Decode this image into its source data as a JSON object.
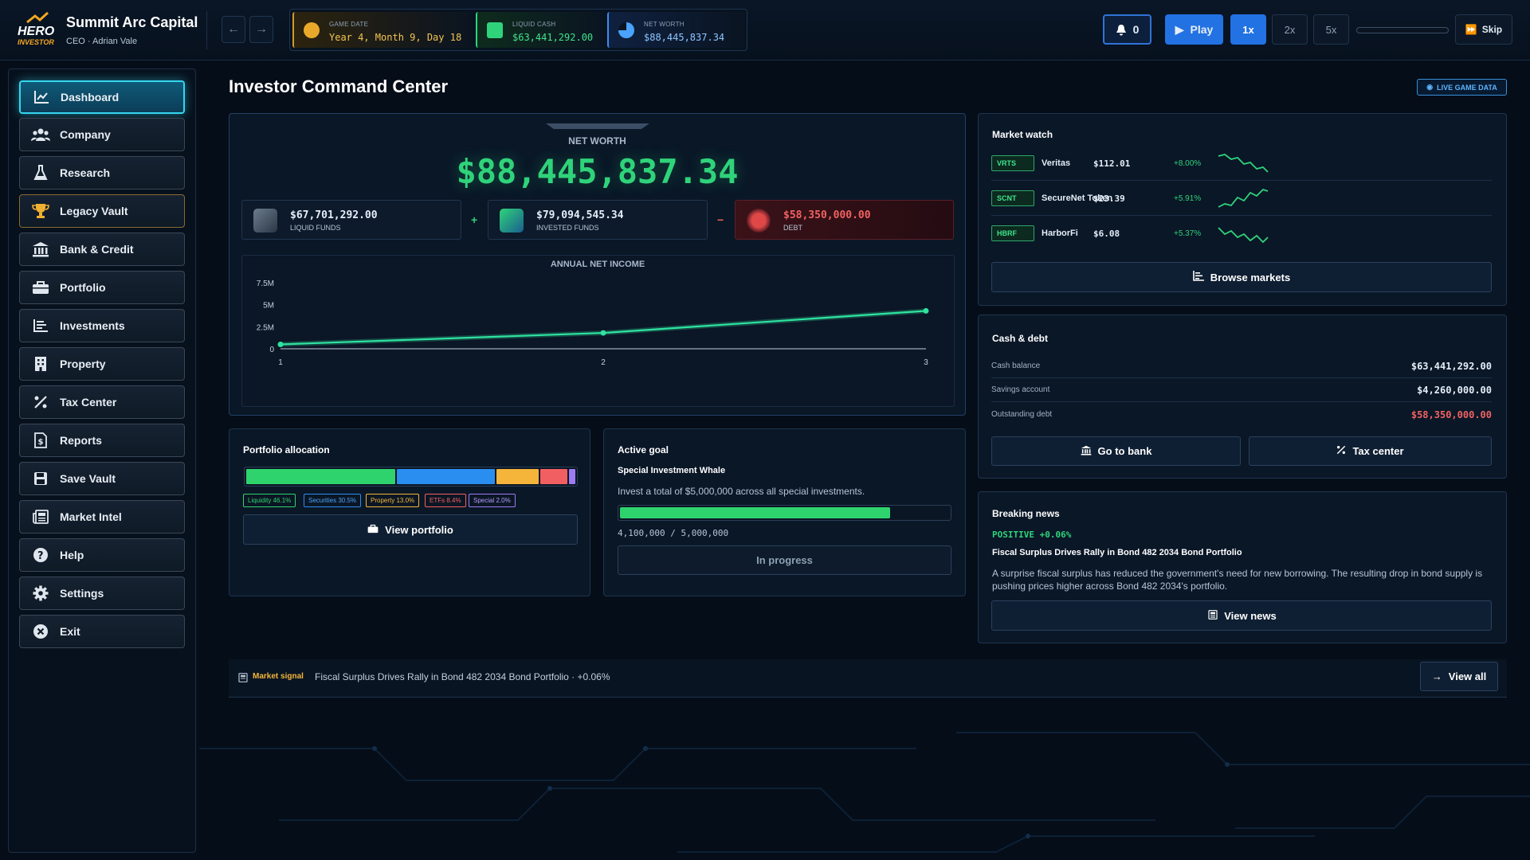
{
  "app": {
    "company_name": "Summit Arc Capital",
    "ceo": "CEO · Adrian Vale",
    "logo_text": "HERO INVESTOR"
  },
  "topbar": {
    "game_date_label": "GAME DATE",
    "game_date": "Year 4, Month 9, Day 18",
    "liquid_cash_label": "LIQUID CASH",
    "liquid_cash": "$63,441,292.00",
    "net_worth_label": "NET WORTH",
    "net_worth": "$88,445,837.34",
    "notifications": "0",
    "play_label": "Play",
    "speeds": [
      "1x",
      "2x",
      "5x"
    ],
    "active_speed": "1x",
    "skip_label": "Skip"
  },
  "sidebar": {
    "items": [
      {
        "label": "Dashboard",
        "icon": "chart-line-icon"
      },
      {
        "label": "Company",
        "icon": "users-icon"
      },
      {
        "label": "Research",
        "icon": "flask-icon"
      },
      {
        "label": "Legacy Vault",
        "icon": "trophy-icon"
      },
      {
        "label": "Bank & Credit",
        "icon": "bank-icon"
      },
      {
        "label": "Portfolio",
        "icon": "briefcase-icon"
      },
      {
        "label": "Investments",
        "icon": "bars-icon"
      },
      {
        "label": "Property",
        "icon": "building-icon"
      },
      {
        "label": "Tax Center",
        "icon": "percent-icon"
      },
      {
        "label": "Reports",
        "icon": "dollar-file-icon"
      },
      {
        "label": "Save Vault",
        "icon": "save-icon"
      },
      {
        "label": "Market Intel",
        "icon": "newspaper-icon"
      },
      {
        "label": "Help",
        "icon": "question-icon"
      },
      {
        "label": "Settings",
        "icon": "gear-icon"
      },
      {
        "label": "Exit",
        "icon": "close-icon"
      }
    ],
    "active": "Dashboard"
  },
  "main": {
    "title": "Investor Command Center",
    "live_badge": "LIVE GAME DATA",
    "net_worth": {
      "label": "NET WORTH",
      "value": "$88,445,837.34",
      "liquid_value": "$67,701,292.00",
      "liquid_label": "LIQUID FUNDS",
      "invested_value": "$79,094,545.34",
      "invested_label": "INVESTED FUNDS",
      "debt_value": "$58,350,000.00",
      "debt_label": "DEBT",
      "plus": "+",
      "minus": "−"
    },
    "market_watch": {
      "title": "Market watch",
      "rows": [
        {
          "ticker": "VRTS",
          "name": "Veritas",
          "price": "$112.01",
          "change": "+8.00%"
        },
        {
          "ticker": "SCNT",
          "name": "SecureNet Token",
          "price": "$23.39",
          "change": "+5.91%"
        },
        {
          "ticker": "HBRF",
          "name": "HarborFi",
          "price": "$6.08",
          "change": "+5.37%"
        }
      ],
      "browse_label": "Browse markets"
    },
    "cash_debt": {
      "title": "Cash & debt",
      "rows": [
        {
          "label": "Cash balance",
          "value": "$63,441,292.00"
        },
        {
          "label": "Savings account",
          "value": "$4,260,000.00"
        },
        {
          "label": "Outstanding debt",
          "value": "$58,350,000.00"
        }
      ],
      "bank_label": "Go to bank",
      "tax_label": "Tax center"
    },
    "allocation": {
      "title": "Portfolio allocation",
      "segments": [
        {
          "label": "Liquidity 46.1%",
          "pct": 46.1,
          "color": "#2fd36e"
        },
        {
          "label": "Securities 30.5%",
          "pct": 30.5,
          "color": "#2a8ef0"
        },
        {
          "label": "Property 13.0%",
          "pct": 13.0,
          "color": "#f5b53a"
        },
        {
          "label": "ETFs 8.4%",
          "pct": 8.4,
          "color": "#f25f62"
        },
        {
          "label": "Special 2.0%",
          "pct": 2.0,
          "color": "#9d7bf3"
        }
      ],
      "button_label": "View portfolio"
    },
    "goal": {
      "title": "Active goal",
      "name": "Special Investment Whale",
      "description": "Invest a total of $5,000,000 across all special investments.",
      "progress_text": "4,100,000 / 5,000,000",
      "progress": 0.82,
      "status_label": "In progress"
    },
    "news": {
      "title": "Breaking news",
      "tag": "POSITIVE +0.06%",
      "headline": "Fiscal Surplus Drives Rally in Bond 482 2034 Bond Portfolio",
      "body": "A surprise fiscal surplus has reduced the government's need for new borrowing. The resulting drop in bond supply is pushing prices higher across Bond 482 2034's portfolio.",
      "button_label": "View news"
    },
    "signal": {
      "label": "Market signal",
      "text": "Fiscal Surplus Drives Rally in Bond 482 2034 Bond Portfolio · +0.06%",
      "button_label": "View all"
    }
  },
  "chart_data": {
    "type": "line",
    "title": "ANNUAL NET INCOME",
    "x": [
      1,
      2,
      3
    ],
    "values": [
      500000,
      1800000,
      4300000
    ],
    "xlabel": "",
    "ylabel": "",
    "ylim": [
      0,
      7500000
    ],
    "y_ticks": [
      0,
      2500000,
      5000000,
      7500000
    ],
    "y_tick_labels": [
      "0",
      "2.5M",
      "5M",
      "7.5M"
    ],
    "x_tick_labels": [
      "1",
      "2",
      "3"
    ],
    "line_color": "#2fe3a0",
    "grid": false
  }
}
